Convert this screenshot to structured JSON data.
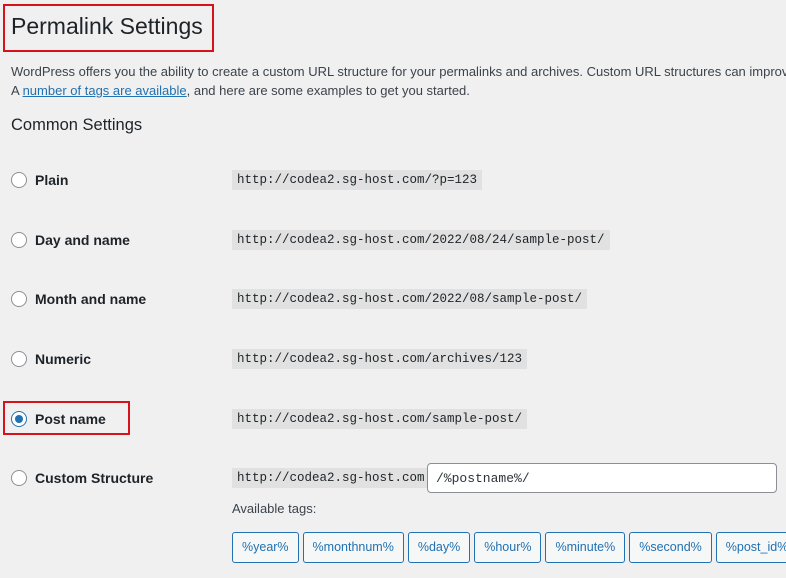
{
  "page_title": "Permalink Settings",
  "intro": {
    "line1": "WordPress offers you the ability to create a custom URL structure for your permalinks and archives. Custom URL structures can improve the aesthetics, usability, and forward-compatibility of your links.",
    "line2_prefix": "A ",
    "line2_link": "number of tags are available",
    "line2_suffix": ", and here are some examples to get you started."
  },
  "section_title": "Common Settings",
  "options": [
    {
      "label": "Plain",
      "example": "http://codea2.sg-host.com/?p=123",
      "checked": false
    },
    {
      "label": "Day and name",
      "example": "http://codea2.sg-host.com/2022/08/24/sample-post/",
      "checked": false
    },
    {
      "label": "Month and name",
      "example": "http://codea2.sg-host.com/2022/08/sample-post/",
      "checked": false
    },
    {
      "label": "Numeric",
      "example": "http://codea2.sg-host.com/archives/123",
      "checked": false
    },
    {
      "label": "Post name",
      "example": "http://codea2.sg-host.com/sample-post/",
      "checked": true
    },
    {
      "label": "Custom Structure",
      "example": "http://codea2.sg-host.com",
      "checked": false
    }
  ],
  "custom_structure_value": "/%postname%/",
  "available_tags_label": "Available tags:",
  "tags": [
    "%year%",
    "%monthnum%",
    "%day%",
    "%hour%",
    "%minute%",
    "%second%",
    "%post_id%"
  ],
  "colors": {
    "accent": "#2271b1",
    "highlight": "#d6121a"
  }
}
